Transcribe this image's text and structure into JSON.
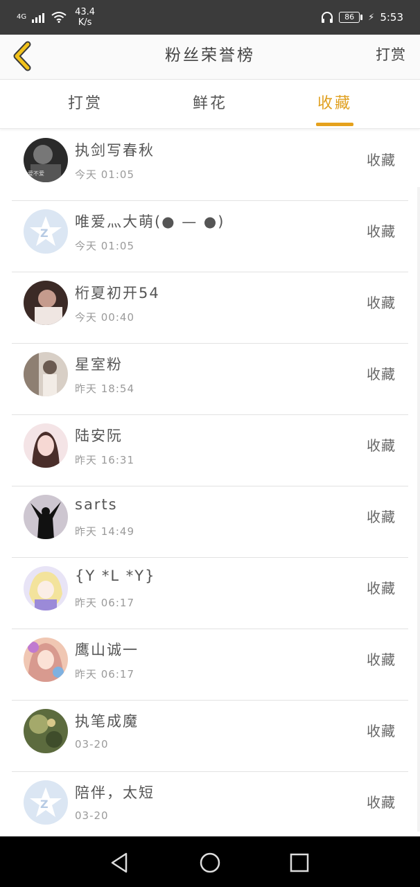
{
  "status_bar": {
    "network": "4G",
    "speed_value": "43.4",
    "speed_unit": "K/s",
    "battery": "86",
    "time": "5:53"
  },
  "header": {
    "title": "粉丝荣誉榜",
    "action": "打赏",
    "accent_color": "#e5a11d"
  },
  "tabs": [
    {
      "label": "打赏"
    },
    {
      "label": "鲜花"
    },
    {
      "label": "收藏",
      "active": true
    }
  ],
  "list": [
    {
      "name": "执剑写春秋",
      "time": "今天 01:05",
      "action": "收藏",
      "avatar": "dark-photo"
    },
    {
      "name": "唯爱灬大萌(● — ●)",
      "time": "今天 01:05",
      "action": "收藏",
      "avatar": "default-qq-logo"
    },
    {
      "name": "桁夏初开54",
      "time": "今天 00:40",
      "action": "收藏",
      "avatar": "photo-person"
    },
    {
      "name": "星室粉",
      "time": "昨天 18:54",
      "action": "收藏",
      "avatar": "photo-room"
    },
    {
      "name": "陆安阮",
      "time": "昨天 16:31",
      "action": "收藏",
      "avatar": "photo-girl"
    },
    {
      "name": "sarts",
      "time": "昨天 14:49",
      "action": "收藏",
      "avatar": "silhouette"
    },
    {
      "name": "{Y *L *Y}",
      "time": "昨天 06:17",
      "action": "收藏",
      "avatar": "anime-blonde"
    },
    {
      "name": "鹰山诚一",
      "time": "昨天 06:17",
      "action": "收藏",
      "avatar": "anime-colorful"
    },
    {
      "name": "执笔成魔",
      "time": "03-20",
      "action": "收藏",
      "avatar": "photo-green"
    },
    {
      "name": "陪伴，太短",
      "time": "03-20",
      "action": "收藏",
      "avatar": "default-qq-logo"
    }
  ]
}
